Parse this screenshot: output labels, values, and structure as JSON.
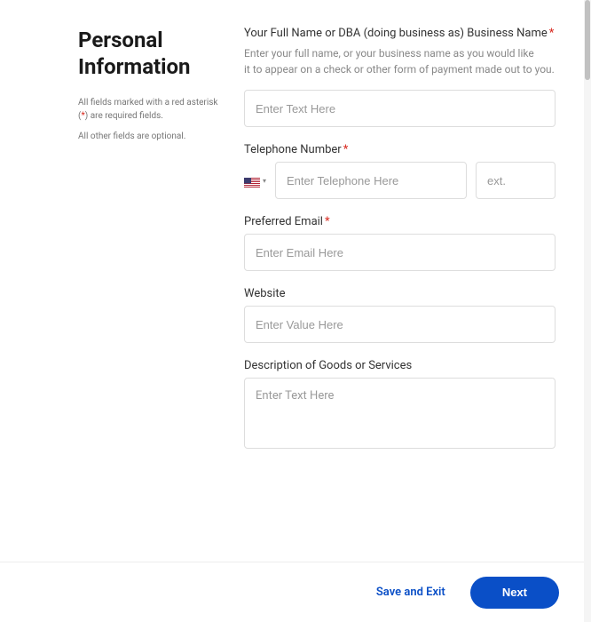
{
  "sidebar": {
    "title": "Personal Information",
    "required_note_pre": "All fields marked with a red asterisk (",
    "required_note_asterisk": "*",
    "required_note_post": ") are required fields.",
    "optional_note": "All other fields are optional."
  },
  "form": {
    "fullname": {
      "label": "Your Full Name or DBA (doing business as) Business Name",
      "help_line1": "Enter your full name, or your business name as you would like",
      "help_line2": "it to appear on a check or other form of payment made out to you.",
      "placeholder": "Enter Text Here"
    },
    "telephone": {
      "label": "Telephone Number",
      "placeholder": "Enter Telephone Here",
      "ext_placeholder": "ext."
    },
    "email": {
      "label": "Preferred Email",
      "placeholder": "Enter Email Here"
    },
    "website": {
      "label": "Website",
      "placeholder": "Enter Value Here"
    },
    "description": {
      "label": "Description of Goods or Services",
      "placeholder": "Enter Text Here"
    }
  },
  "footer": {
    "save_exit": "Save and Exit",
    "next": "Next"
  }
}
